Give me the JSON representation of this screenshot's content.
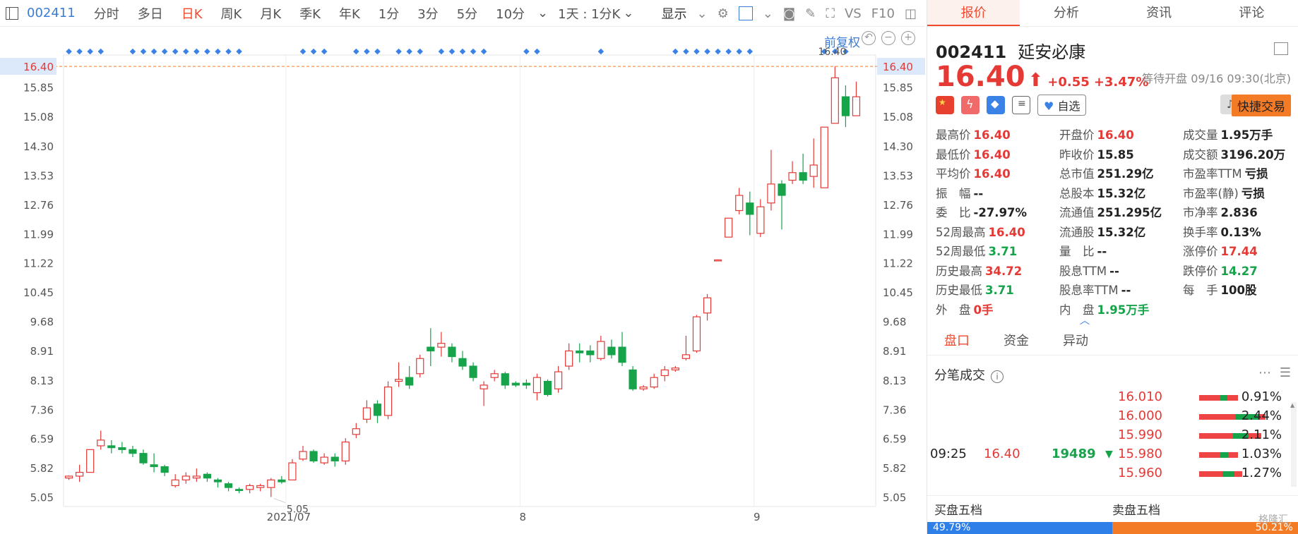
{
  "toolbar": {
    "code": "002411",
    "timeframes": [
      "分时",
      "多日",
      "日K",
      "周K",
      "月K",
      "季K",
      "年K",
      "1分",
      "3分",
      "5分",
      "10分"
    ],
    "active_index": 2,
    "period_dropdown": "1天 : 1分K",
    "display_label": "显示",
    "vs_label": "VS",
    "f10_label": "F10"
  },
  "chart": {
    "restore_label": "前复权",
    "y_ticks": [
      "16.40",
      "15.85",
      "15.08",
      "14.30",
      "13.53",
      "12.76",
      "11.99",
      "11.22",
      "10.45",
      "9.68",
      "8.91",
      "8.13",
      "7.36",
      "6.59",
      "5.82",
      "5.05"
    ],
    "x_labels": [
      "2021/07",
      "8",
      "9"
    ],
    "high_annotation": "16.40",
    "low_annotation": "5.05",
    "current_price_label": "16.40",
    "colors": {
      "up": "#e53935",
      "down": "#16a34a",
      "marker": "#3b82e6"
    }
  },
  "chart_data": {
    "type": "candlestick",
    "series": [
      {
        "ohlc": [
          [
            5.55,
            5.6,
            5.5,
            5.62
          ],
          [
            5.6,
            5.7,
            5.45,
            5.9
          ],
          [
            5.7,
            6.3,
            5.7,
            6.3
          ],
          [
            6.4,
            6.55,
            6.3,
            6.8
          ],
          [
            6.4,
            6.35,
            6.2,
            6.55
          ],
          [
            6.35,
            6.3,
            6.2,
            6.5
          ],
          [
            6.3,
            6.2,
            6.1,
            6.4
          ],
          [
            6.2,
            5.95,
            5.9,
            6.3
          ],
          [
            5.9,
            5.85,
            5.7,
            6.2
          ],
          [
            5.85,
            5.7,
            5.6,
            5.9
          ],
          [
            5.35,
            5.5,
            5.3,
            5.65
          ],
          [
            5.5,
            5.6,
            5.4,
            5.7
          ],
          [
            5.55,
            5.6,
            5.45,
            5.8
          ],
          [
            5.65,
            5.55,
            5.45,
            5.7
          ],
          [
            5.5,
            5.45,
            5.3,
            5.55
          ],
          [
            5.4,
            5.3,
            5.2,
            5.45
          ],
          [
            5.25,
            5.22,
            5.15,
            5.3
          ],
          [
            5.25,
            5.35,
            5.15,
            5.4
          ],
          [
            5.3,
            5.35,
            5.2,
            5.4
          ],
          [
            5.3,
            5.5,
            5.05,
            5.55
          ],
          [
            5.5,
            5.45,
            5.4,
            5.6
          ],
          [
            5.5,
            5.95,
            5.5,
            6.05
          ],
          [
            6.05,
            6.25,
            6.0,
            6.4
          ],
          [
            6.25,
            6.0,
            5.95,
            6.3
          ],
          [
            5.95,
            6.1,
            5.9,
            6.2
          ],
          [
            6.1,
            6.0,
            5.85,
            6.2
          ],
          [
            6.0,
            6.5,
            5.9,
            6.6
          ],
          [
            6.7,
            6.85,
            6.6,
            7.0
          ],
          [
            7.1,
            7.4,
            7.0,
            7.6
          ],
          [
            7.5,
            7.2,
            7.0,
            7.6
          ],
          [
            7.2,
            7.95,
            7.1,
            8.1
          ],
          [
            8.1,
            8.15,
            7.95,
            8.6
          ],
          [
            8.2,
            8.0,
            7.9,
            8.5
          ],
          [
            8.3,
            8.7,
            8.2,
            8.8
          ],
          [
            9.0,
            8.9,
            8.5,
            9.5
          ],
          [
            9.0,
            9.1,
            8.75,
            9.4
          ],
          [
            9.0,
            8.75,
            8.6,
            9.1
          ],
          [
            8.7,
            8.5,
            8.4,
            8.9
          ],
          [
            8.5,
            8.2,
            8.1,
            8.6
          ],
          [
            7.9,
            8.0,
            7.45,
            8.1
          ],
          [
            8.2,
            8.3,
            8.1,
            8.4
          ],
          [
            8.3,
            8.0,
            7.9,
            8.35
          ],
          [
            8.05,
            8.0,
            7.95,
            8.1
          ],
          [
            8.05,
            8.0,
            7.9,
            8.15
          ],
          [
            7.8,
            8.2,
            7.6,
            8.3
          ],
          [
            8.1,
            7.75,
            7.7,
            8.15
          ],
          [
            7.9,
            8.35,
            7.8,
            8.5
          ],
          [
            8.5,
            8.9,
            8.4,
            9.1
          ],
          [
            8.9,
            8.85,
            8.6,
            9.1
          ],
          [
            8.9,
            8.8,
            8.6,
            9.05
          ],
          [
            8.7,
            9.15,
            8.65,
            9.3
          ],
          [
            9.0,
            8.8,
            8.7,
            9.2
          ],
          [
            9.0,
            8.6,
            8.5,
            9.4
          ],
          [
            8.4,
            7.9,
            7.85,
            8.5
          ],
          [
            7.9,
            7.95,
            7.85,
            8.0
          ],
          [
            7.95,
            8.2,
            7.9,
            8.3
          ],
          [
            8.25,
            8.4,
            8.1,
            8.5
          ],
          [
            8.4,
            8.45,
            8.35,
            8.5
          ],
          [
            8.7,
            8.8,
            8.65,
            9.3
          ],
          [
            8.9,
            9.8,
            8.85,
            9.85
          ],
          [
            9.9,
            10.3,
            9.7,
            10.4
          ],
          [
            11.3,
            11.3,
            11.3,
            11.3
          ],
          [
            11.9,
            12.4,
            11.9,
            12.4
          ],
          [
            12.6,
            13.0,
            12.5,
            13.2
          ],
          [
            12.8,
            12.5,
            11.95,
            13.1
          ],
          [
            12.0,
            12.7,
            11.9,
            12.9
          ],
          [
            12.8,
            13.3,
            12.6,
            14.2
          ],
          [
            13.3,
            13.0,
            12.1,
            13.4
          ],
          [
            13.4,
            13.6,
            13.3,
            13.9
          ],
          [
            13.6,
            13.4,
            13.3,
            14.1
          ],
          [
            13.5,
            13.8,
            13.2,
            14.5
          ],
          [
            13.2,
            14.8,
            13.2,
            14.8
          ],
          [
            14.9,
            16.1,
            14.9,
            16.4
          ],
          [
            15.6,
            15.1,
            14.8,
            15.9
          ],
          [
            15.1,
            15.6,
            15.3,
            16.0
          ]
        ]
      }
    ],
    "ylim": [
      4.8,
      16.7
    ],
    "xlabel": "",
    "ylabel": ""
  },
  "quote": {
    "code": "002411",
    "name": "延安必康",
    "price": "16.40",
    "arrow": "⬆",
    "change": "+0.55",
    "change_pct": "+3.47%",
    "status": "等待开盘 09/16 09:30(北京)",
    "zixuan_label": "自选",
    "quick_trade_label": "快捷交易",
    "rows": [
      [
        {
          "k": "最高价",
          "v": "16.40",
          "c": "red"
        },
        {
          "k": "开盘价",
          "v": "16.40",
          "c": "red"
        },
        {
          "k": "成交量",
          "v": "1.95万手",
          "c": ""
        }
      ],
      [
        {
          "k": "最低价",
          "v": "16.40",
          "c": "red"
        },
        {
          "k": "昨收价",
          "v": "15.85",
          "c": ""
        },
        {
          "k": "成交额",
          "v": "3196.20万",
          "c": ""
        }
      ],
      [
        {
          "k": "平均价",
          "v": "16.40",
          "c": "red"
        },
        {
          "k": "总市值",
          "v": "251.29亿",
          "c": ""
        },
        {
          "k": "市盈率TTM",
          "v": "亏损",
          "c": ""
        }
      ],
      [
        {
          "k": "振　幅",
          "v": "--",
          "c": ""
        },
        {
          "k": "总股本",
          "v": "15.32亿",
          "c": ""
        },
        {
          "k": "市盈率(静)",
          "v": "亏损",
          "c": ""
        }
      ],
      [
        {
          "k": "委　比",
          "v": "-27.97%",
          "c": ""
        },
        {
          "k": "流通值",
          "v": "251.295亿",
          "c": ""
        },
        {
          "k": "市净率",
          "v": "2.836",
          "c": ""
        }
      ],
      [
        {
          "k": "52周最高",
          "v": "16.40",
          "c": "red"
        },
        {
          "k": "流通股",
          "v": "15.32亿",
          "c": ""
        },
        {
          "k": "换手率",
          "v": "0.13%",
          "c": ""
        }
      ],
      [
        {
          "k": "52周最低",
          "v": "3.71",
          "c": "green"
        },
        {
          "k": "量　比",
          "v": "--",
          "c": ""
        },
        {
          "k": "涨停价",
          "v": "17.44",
          "c": "red"
        }
      ],
      [
        {
          "k": "历史最高",
          "v": "34.72",
          "c": "red"
        },
        {
          "k": "股息TTM",
          "v": "--",
          "c": ""
        },
        {
          "k": "跌停价",
          "v": "14.27",
          "c": "green"
        }
      ],
      [
        {
          "k": "历史最低",
          "v": "3.71",
          "c": "green"
        },
        {
          "k": "股息率TTM",
          "v": "--",
          "c": ""
        },
        {
          "k": "每　手",
          "v": "100股",
          "c": ""
        }
      ],
      [
        {
          "k": "外　盘",
          "v": "0手",
          "c": "red"
        },
        {
          "k": "内　盘",
          "v": "1.95万手",
          "c": "green"
        },
        {
          "k": "",
          "v": "",
          "c": ""
        }
      ]
    ]
  },
  "tabs": [
    "报价",
    "分析",
    "资讯",
    "评论"
  ],
  "subtabs": [
    "盘口",
    "资金",
    "异动"
  ],
  "trades": {
    "title": "分笔成交",
    "current": {
      "time": "09:25",
      "price": "16.40",
      "vol": "19489",
      "arrow": "▼"
    },
    "levels": [
      {
        "price": "16.010",
        "pct": "0.91%",
        "red": 0.5,
        "green": 0.18
      },
      {
        "price": "16.000",
        "pct": "2.44%",
        "red": 0.85,
        "green": 0.6
      },
      {
        "price": "15.990",
        "pct": "2.11%",
        "red": 0.8,
        "green": 0.4
      },
      {
        "price": "15.980",
        "pct": "1.03%",
        "red": 0.5,
        "green": 0.2
      },
      {
        "price": "15.960",
        "pct": "1.27%",
        "red": 0.55,
        "green": 0.3
      }
    ]
  },
  "five": {
    "buy_label": "买盘五档",
    "sell_label": "卖盘五档",
    "buy_pct": "49.79%",
    "sell_pct": "50.21%",
    "buy_frac": 0.4979
  },
  "watermark": "格隆汇"
}
